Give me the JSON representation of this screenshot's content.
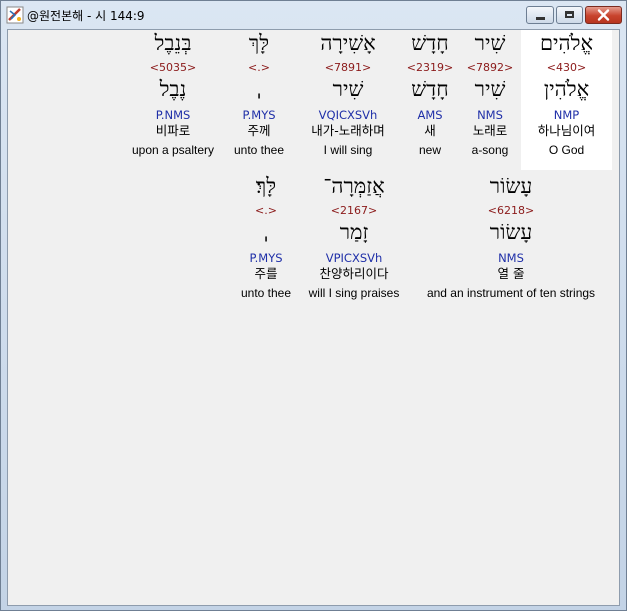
{
  "window": {
    "title": "@원전본해 - 시 144:9",
    "icon": "app-icon",
    "controls": [
      "minimize-icon",
      "maximize-icon",
      "close-icon"
    ]
  },
  "line1": [
    {
      "heb": "אֱלֹהִים",
      "strong": "<430>",
      "lemma": "אֱלֹהִין",
      "morph": "NMP",
      "kor": "하나님이여",
      "eng": "O God",
      "selected": true
    },
    {
      "heb": "שִׁיר",
      "strong": "<7892>",
      "lemma": "שִׁיר",
      "morph": "NMS",
      "kor": "노래로",
      "eng": "a-song"
    },
    {
      "heb": "חָדָשׁ",
      "strong": "<2319>",
      "lemma": "חָדָשׁ",
      "morph": "AMS",
      "kor": "새",
      "eng": "new"
    },
    {
      "heb": "אָשִׁירָה",
      "strong": "<7891>",
      "lemma": "שִׁיר",
      "morph": "VQICXSVh",
      "kor": "내가-노래하며",
      "eng": "I will sing"
    },
    {
      "heb": "לָּךְ",
      "strong": "<.>",
      "lemma": "ˌ",
      "morph": "P.MYS",
      "kor": "주께",
      "eng": "unto thee"
    },
    {
      "heb": "בְּנֵבֶל",
      "strong": "<5035>",
      "lemma": "נֶבֶל",
      "morph": "P.NMS",
      "kor": "비파로",
      "eng": "upon a psaltery"
    }
  ],
  "line2": [
    {
      "heb": "עָשׂוֹר",
      "strong": "<6218>",
      "lemma": "עָשׂוֹר",
      "morph": "NMS",
      "kor": "열 줄",
      "eng": "and an instrument of ten strings"
    },
    {
      "heb": "אֲזַמְּרָה־",
      "strong": "<2167>",
      "lemma": "זָמַר",
      "morph": "VPICXSVh",
      "kor": "찬양하리이다",
      "eng": "will I sing praises"
    },
    {
      "heb": "לָּךְ׃",
      "strong": "<.>",
      "lemma": "ˌ",
      "morph": "P.MYS",
      "kor": "주를",
      "eng": "unto thee"
    }
  ]
}
